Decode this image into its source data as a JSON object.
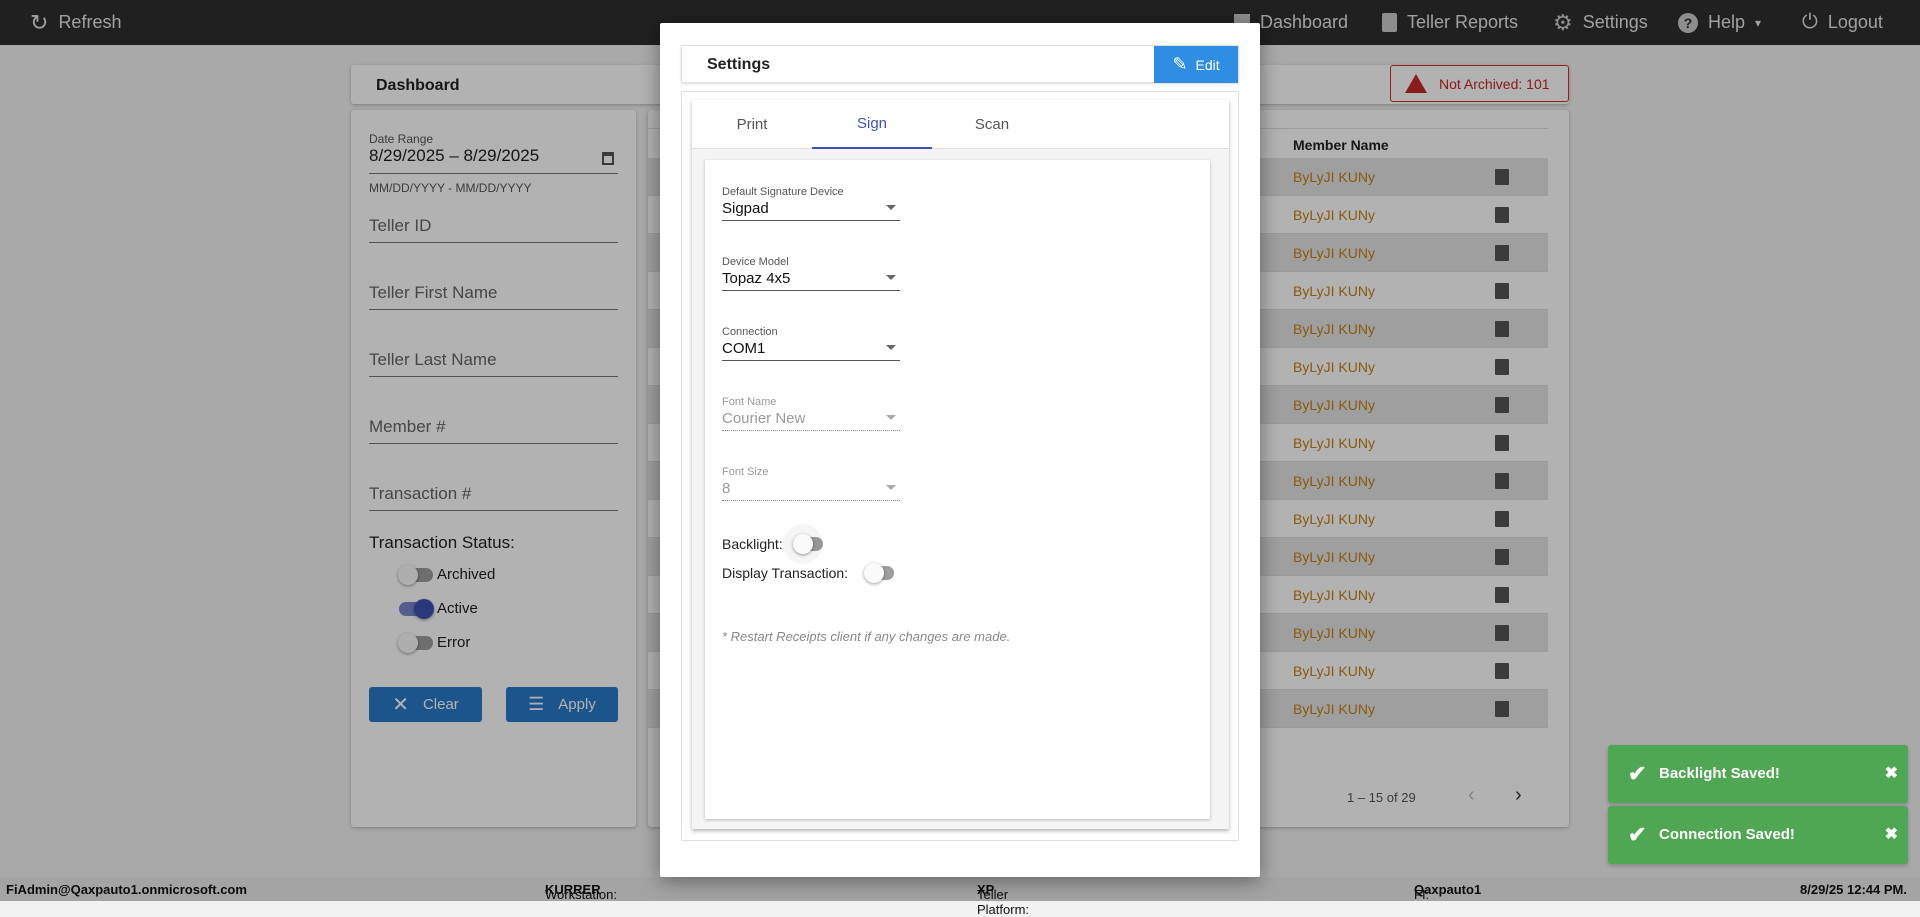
{
  "topbar": {
    "refresh": "Refresh",
    "dashboard": "Dashboard",
    "teller_reports": "Teller Reports",
    "settings": "Settings",
    "help": "Help",
    "logout": "Logout"
  },
  "dashboard": {
    "title": "Dashboard",
    "badge": "Not Archived: 101"
  },
  "filters": {
    "date_label": "Date Range",
    "date_value": "8/29/2025 – 8/29/2025",
    "date_hint": "MM/DD/YYYY - MM/DD/YYYY",
    "teller_id": "Teller ID",
    "first_name": "Teller First Name",
    "last_name": "Teller Last Name",
    "member": "Member #",
    "transaction": "Transaction #",
    "status_label": "Transaction Status:",
    "archived": "Archived",
    "active": "Active",
    "error": "Error",
    "clear": "Clear",
    "apply": "Apply"
  },
  "table": {
    "member_header": "Member Name",
    "rows": [
      "ByLyJI KUNy",
      "ByLyJI KUNy",
      "ByLyJI KUNy",
      "ByLyJI KUNy",
      "ByLyJI KUNy",
      "ByLyJI KUNy",
      "ByLyJI KUNy",
      "ByLyJI KUNy",
      "ByLyJI KUNy",
      "ByLyJI KUNy",
      "ByLyJI KUNy",
      "ByLyJI KUNy",
      "ByLyJI KUNy",
      "ByLyJI KUNy",
      "ByLyJI KUNy"
    ],
    "pagination": "1 – 15 of 29"
  },
  "modal": {
    "title": "Settings",
    "edit": "Edit",
    "tabs": [
      "Print",
      "Sign",
      "Scan"
    ],
    "fields": [
      {
        "label": "Default Signature Device",
        "value": "Sigpad"
      },
      {
        "label": "Device Model",
        "value": "Topaz 4x5"
      },
      {
        "label": "Connection",
        "value": "COM1"
      },
      {
        "label": "Font Name",
        "value": "Courier New"
      },
      {
        "label": "Font Size",
        "value": "8"
      }
    ],
    "backlight": "Backlight:",
    "display_transaction": "Display Transaction:",
    "note": "* Restart Receipts client if any changes are made."
  },
  "toasts": [
    "Backlight Saved!",
    "Connection Saved!"
  ],
  "status": {
    "user": "FiAdmin@Qaxpauto1.onmicrosoft.com",
    "ws_label": "Workstation:",
    "ws": "KURRER",
    "tp_label": "Teller Platform:",
    "tp": "XP",
    "fi_label": "FI:",
    "fi": "Qaxpauto1",
    "time": "8/29/25 12:44 PM."
  }
}
